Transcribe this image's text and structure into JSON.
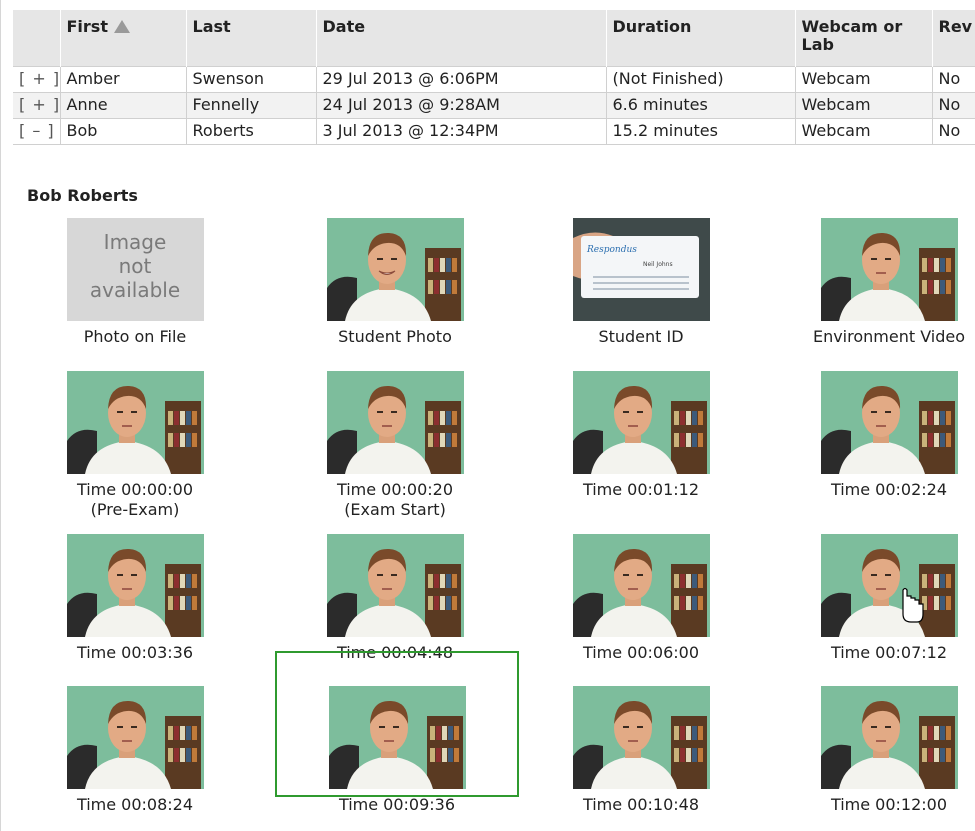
{
  "table": {
    "headers": {
      "first": "First",
      "last": "Last",
      "date": "Date",
      "duration": "Duration",
      "webcam": "Webcam or Lab",
      "reviewed": "Rev"
    },
    "rows": [
      {
        "toggle": "[ + ]",
        "first": "Amber",
        "last": "Swenson",
        "date": "29 Jul 2013 @ 6:06PM",
        "duration": "(Not Finished)",
        "webcam": "Webcam",
        "reviewed": "No"
      },
      {
        "toggle": "[ + ]",
        "first": "Anne",
        "last": "Fennelly",
        "date": "24 Jul 2013 @ 9:28AM",
        "duration": "6.6 minutes",
        "webcam": "Webcam",
        "reviewed": "No"
      },
      {
        "toggle": "[ – ]",
        "first": "Bob",
        "last": "Roberts",
        "date": "3 Jul 2013 @ 12:34PM",
        "duration": "15.2 minutes",
        "webcam": "Webcam",
        "reviewed": "No"
      }
    ]
  },
  "detail": {
    "name": "Bob Roberts",
    "not_available": [
      "Image",
      "not",
      "available"
    ],
    "items": [
      {
        "label": "Photo on File",
        "kind": "na"
      },
      {
        "label": "Student Photo",
        "kind": "smile"
      },
      {
        "label": "Student ID",
        "kind": "id"
      },
      {
        "label": "Environment Video",
        "kind": "env"
      },
      {
        "label": "Time 00:00:00",
        "sub": "(Pre-Exam)",
        "kind": "face"
      },
      {
        "label": "Time 00:00:20",
        "sub": "(Exam Start)",
        "kind": "face"
      },
      {
        "label": "Time 00:01:12",
        "kind": "face"
      },
      {
        "label": "Time 00:02:24",
        "kind": "face"
      },
      {
        "label": "Time 00:03:36",
        "kind": "face"
      },
      {
        "label": "Time 00:04:48",
        "kind": "face"
      },
      {
        "label": "Time 00:06:00",
        "kind": "face"
      },
      {
        "label": "Time 00:07:12",
        "kind": "face",
        "cursor": true
      },
      {
        "label": "Time 00:08:24",
        "kind": "face"
      },
      {
        "label": "Time 00:09:36",
        "kind": "face",
        "selected": true
      },
      {
        "label": "Time 00:10:48",
        "kind": "face"
      },
      {
        "label": "Time 00:12:00",
        "kind": "face"
      }
    ],
    "id_card": {
      "brand": "Respondus",
      "name": "Neil Johns"
    }
  },
  "colors": {
    "wall": "#7dbd9c",
    "selected_border": "#2f9a2f",
    "header_bg": "#e6e6e6"
  }
}
